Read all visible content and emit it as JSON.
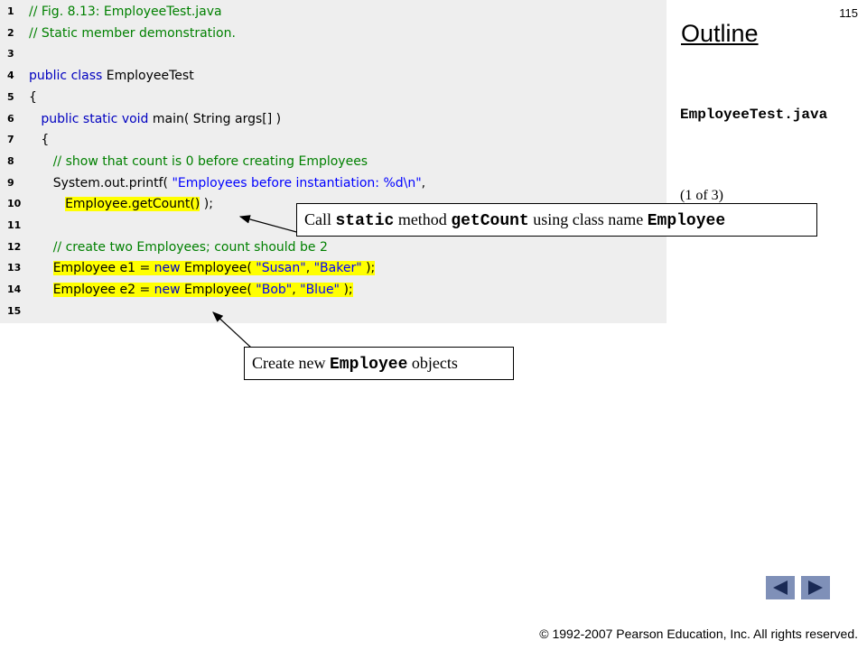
{
  "page": {
    "number": "115",
    "outline_title": "Outline",
    "file_name": "EmployeeTest.java",
    "part_label": "(1 of  3)",
    "copyright": "© 1992-2007 Pearson Education, Inc.  All rights reserved."
  },
  "code": {
    "lines": [
      {
        "n": "1",
        "parts": [
          {
            "t": "// Fig. 8.13: EmployeeTest.java",
            "c": "cm"
          }
        ]
      },
      {
        "n": "2",
        "parts": [
          {
            "t": "// Static member demonstration.",
            "c": "cm"
          }
        ]
      },
      {
        "n": "3",
        "parts": []
      },
      {
        "n": "4",
        "parts": [
          {
            "t": "public class ",
            "c": "kw"
          },
          {
            "t": "EmployeeTest",
            "c": "tx"
          }
        ]
      },
      {
        "n": "5",
        "parts": [
          {
            "t": "{",
            "c": "tx"
          }
        ]
      },
      {
        "n": "6",
        "parts": [
          {
            "t": "   public static void ",
            "c": "kw"
          },
          {
            "t": "main( String args[] )",
            "c": "tx"
          }
        ]
      },
      {
        "n": "7",
        "parts": [
          {
            "t": "   {",
            "c": "tx"
          }
        ]
      },
      {
        "n": "8",
        "parts": [
          {
            "t": "      // show that count is 0 before creating Employees",
            "c": "cm"
          }
        ]
      },
      {
        "n": "9",
        "parts": [
          {
            "t": "      System.out.printf( ",
            "c": "tx"
          },
          {
            "t": "\"Employees before instantiation: %d\\n\"",
            "c": "st"
          },
          {
            "t": ",",
            "c": "tx"
          }
        ]
      },
      {
        "n": "10",
        "parts": [
          {
            "t": "         ",
            "c": "tx"
          },
          {
            "t": "Employee.getCount()",
            "c": "tx",
            "hl": true
          },
          {
            "t": " );",
            "c": "tx"
          }
        ]
      },
      {
        "n": "11",
        "parts": []
      },
      {
        "n": "12",
        "parts": [
          {
            "t": "      // create two Employees; count should be 2",
            "c": "cm"
          }
        ]
      },
      {
        "n": "13",
        "parts": [
          {
            "t": "      ",
            "c": "tx"
          },
          {
            "t": "Employee e1 = ",
            "c": "tx",
            "hl": true
          },
          {
            "t": "new ",
            "c": "kw",
            "hl": true
          },
          {
            "t": "Employee( ",
            "c": "tx",
            "hl": true
          },
          {
            "t": "\"Susan\"",
            "c": "st",
            "hl": true
          },
          {
            "t": ", ",
            "c": "tx",
            "hl": true
          },
          {
            "t": "\"Baker\"",
            "c": "st",
            "hl": true
          },
          {
            "t": " );",
            "c": "tx",
            "hl": true
          }
        ]
      },
      {
        "n": "14",
        "parts": [
          {
            "t": "      ",
            "c": "tx"
          },
          {
            "t": "Employee e2 = ",
            "c": "tx",
            "hl": true
          },
          {
            "t": "new ",
            "c": "kw",
            "hl": true
          },
          {
            "t": "Employee( ",
            "c": "tx",
            "hl": true
          },
          {
            "t": "\"Bob\"",
            "c": "st",
            "hl": true
          },
          {
            "t": ", ",
            "c": "tx",
            "hl": true
          },
          {
            "t": "\"Blue\"",
            "c": "st",
            "hl": true
          },
          {
            "t": " );",
            "c": "tx",
            "hl": true
          }
        ]
      },
      {
        "n": "15",
        "parts": []
      }
    ]
  },
  "callouts": {
    "call_static": {
      "pre": "Call ",
      "code1": "static",
      "mid": " method ",
      "code2": "getCount",
      "mid2": " using class name ",
      "code3": "Employee"
    },
    "create_objects": {
      "pre": "Create new ",
      "code1": "Employee",
      "post": " objects"
    }
  },
  "nav": {
    "prev_icon": "triangle-left-icon",
    "next_icon": "triangle-right-icon"
  },
  "colors": {
    "code_bg": "#eeeeee",
    "highlight": "#ffff00",
    "keyword": "#0000c0",
    "comment": "#008000",
    "string": "#0000ff",
    "nav_button": "#7f90b8"
  }
}
